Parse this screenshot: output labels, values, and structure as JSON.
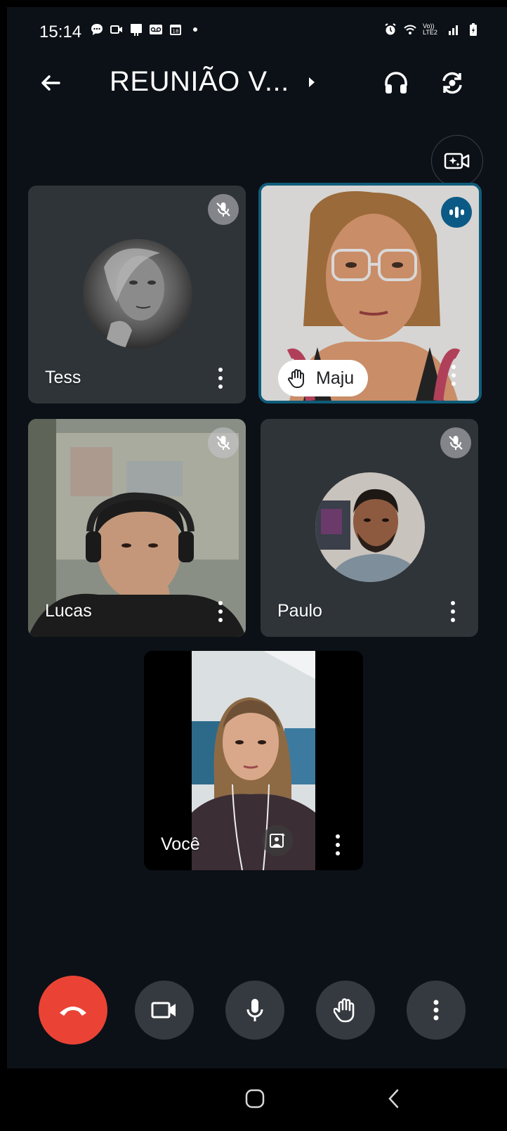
{
  "status_bar": {
    "time": "15:14",
    "network_label": "Vo))\nLTE2"
  },
  "header": {
    "title": "REUNIÃO V...",
    "back_icon": "arrow-left-icon",
    "audio_icon": "headphones-icon",
    "switch_camera_icon": "camera-switch-icon"
  },
  "effects_button": {
    "icon": "camera-sparkle-icon"
  },
  "participants": [
    {
      "name": "Tess",
      "muted": true,
      "video": false,
      "avatar_shade": "#5a5a5a"
    },
    {
      "name": "Maju",
      "muted": false,
      "video": true,
      "speaking": true,
      "hand_raised": true,
      "highlight_color": "#0f5c7a"
    },
    {
      "name": "Lucas",
      "muted": true,
      "video": true
    },
    {
      "name": "Paulo",
      "muted": true,
      "video": false
    },
    {
      "name": "Você",
      "self": true,
      "video": true
    }
  ],
  "controls": {
    "end_call_color": "#ea4335",
    "button_bg": "#353a40",
    "items": [
      "end-call-icon",
      "video-camera-icon",
      "microphone-icon",
      "raise-hand-icon",
      "more-vert-icon"
    ]
  },
  "colors": {
    "background": "#0c1117",
    "tile_bg": "#2f3439",
    "speaking_badge": "#0b5a85"
  }
}
